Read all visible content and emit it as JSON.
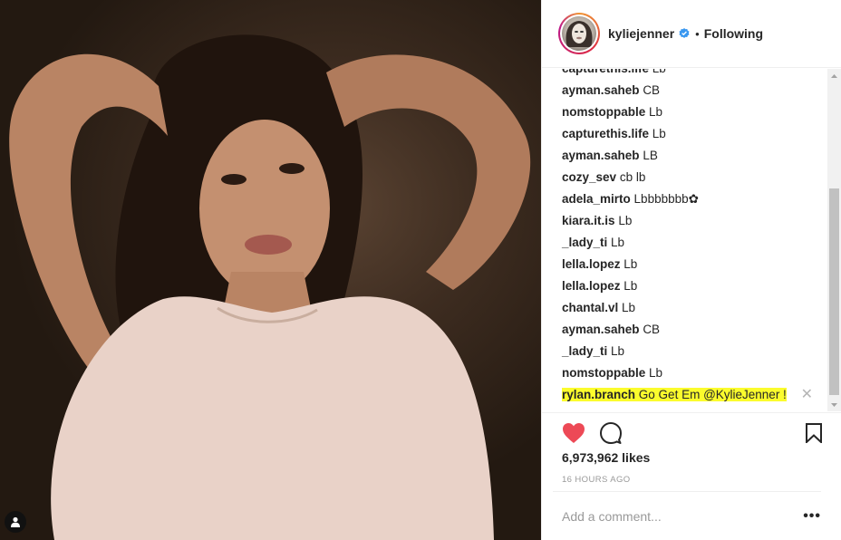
{
  "post": {
    "username": "kyliejenner",
    "separator": "•",
    "follow_status": "Following",
    "likes": "6,973,962 likes",
    "timestamp": "16 HOURS AGO"
  },
  "comments": [
    {
      "user": "capturethis.life",
      "text": "Lb"
    },
    {
      "user": "ayman.saheb",
      "text": "CB"
    },
    {
      "user": "nomstoppable",
      "text": "Lb"
    },
    {
      "user": "capturethis.life",
      "text": "Lb"
    },
    {
      "user": "ayman.saheb",
      "text": "LB"
    },
    {
      "user": "cozy_sev",
      "text": "cb lb"
    },
    {
      "user": "adela_mirto",
      "text": "Lbbbbbbb✿"
    },
    {
      "user": "kiara.it.is",
      "text": "Lb"
    },
    {
      "user": "_lady_ti",
      "text": "Lb"
    },
    {
      "user": "lella.lopez",
      "text": "Lb"
    },
    {
      "user": "lella.lopez",
      "text": "Lb"
    },
    {
      "user": "chantal.vl",
      "text": "Lb"
    },
    {
      "user": "ayman.saheb",
      "text": "CB"
    },
    {
      "user": "_lady_ti",
      "text": "Lb"
    },
    {
      "user": "nomstoppable",
      "text": "Lb"
    },
    {
      "user": "rylan.branch",
      "text": "Go Get Em @KylieJenner !",
      "highlight": true
    }
  ],
  "comment_input": {
    "placeholder": "Add a comment..."
  },
  "more_label": "•••",
  "close_label": "✕",
  "icons": {
    "heart": "heart-icon",
    "comment": "comment-icon",
    "bookmark": "bookmark-icon",
    "verified": "verified-badge-icon",
    "tag": "user-tag-icon"
  },
  "colors": {
    "heart": "#ed4956",
    "verified": "#3897f0",
    "highlight": "#fbfc2d"
  }
}
